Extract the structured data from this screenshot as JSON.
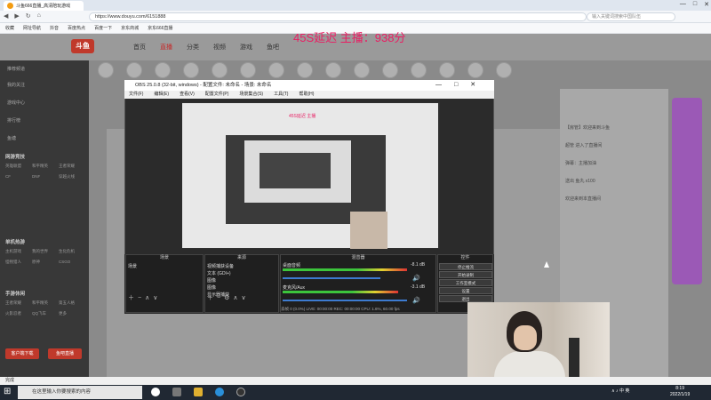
{
  "browser": {
    "tab_title": "斗鱼666直播_高清陪玩游戏",
    "url": "https://www.douyu.com/6151888",
    "search_placeholder": "输入关键词搜索中国队伍",
    "bookmarks": [
      "收藏",
      "网址导航",
      "抖音",
      "百度热点",
      "百度一下",
      "京东商城",
      "京东666直播"
    ]
  },
  "site": {
    "logo": "斗鱼",
    "nav": [
      "首页",
      "直播",
      "分类",
      "视频",
      "游戏",
      "鱼吧"
    ],
    "overlay_text": "45S延迟 主播：938分"
  },
  "left_sidebar": {
    "items": [
      "推荐频道",
      "我的关注",
      "游戏中心",
      "排行榜",
      "鱼塘"
    ],
    "sections": [
      {
        "title": "网游竞技",
        "items": [
          "英雄联盟",
          "和平精英",
          "王者荣耀",
          "CF",
          "DNF",
          "穿越火线"
        ]
      },
      {
        "title": "单机热游",
        "items": [
          "主机游戏",
          "我的世界",
          "生化危机",
          "怪物猎人",
          "原神",
          "CSGO"
        ]
      },
      {
        "title": "手游休闲",
        "items": [
          "王者荣耀",
          "和平精英",
          "第五人格",
          "火影忍者",
          "QQ飞车",
          "更多"
        ]
      }
    ],
    "buttons": [
      "客户端下载",
      "鱼吧直播"
    ]
  },
  "obs": {
    "title": "OBS 25.0.8 (32-bit, windows) - 配置文件: 未命名 - 场景: 未命名",
    "menu": [
      "文件(F)",
      "编辑(E)",
      "查看(V)",
      "配置文件(P)",
      "场景集合(S)",
      "工具(T)",
      "帮助(H)"
    ],
    "window_buttons": [
      "—",
      "□",
      "✕"
    ],
    "nested_text": "45S延迟 主播",
    "docks": {
      "scenes_header": "场景",
      "scenes": [
        "场景"
      ],
      "sources_header": "来源",
      "sources": [
        "视频捕获设备",
        "文本 (GDI+)",
        "图像",
        "图像",
        "显示器捕获"
      ],
      "mixer_header": "混音器",
      "mixer": [
        {
          "name": "桌面音频",
          "db": "-8.1 dB"
        },
        {
          "name": "麦克风/Aux",
          "db": "-3.1 dB"
        }
      ],
      "controls_header": "控件",
      "controls": [
        "停止推流",
        "开始录制",
        "工作室模式",
        "设置",
        "退出"
      ]
    },
    "status": "丢帧 0 (0.0%)   LIVE: 00:00:00   REC: 00:00:00   CPU: 1.6%, 60.00 fps"
  },
  "chat": [
    "【房管】欢迎来到斗鱼",
    "超管 进入了直播间",
    "弹幕：主播加油",
    "送出 鱼丸 x100",
    "欢迎来到本直播间"
  ],
  "taskbar": {
    "search_placeholder": "在这里输入你要搜索的内容",
    "tray_text": "∧ ♪ 中 英",
    "time": "8:19",
    "date": "2022/1/19"
  },
  "page_status": "完成"
}
